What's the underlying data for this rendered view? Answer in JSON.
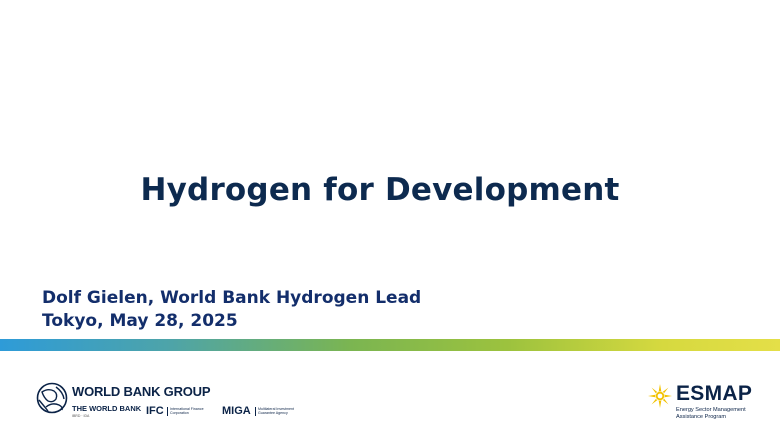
{
  "slide": {
    "title": "Hydrogen for Development",
    "presenter_line1": "Dolf Gielen, World Bank Hydrogen Lead",
    "presenter_line2": "Tokyo, May 28, 2025"
  },
  "colors": {
    "title": "#0d2a4f",
    "presenter": "#132e6b",
    "band_start": "#2e9bd8",
    "band_mid": "#7bb551",
    "band_end": "#e4df48"
  },
  "footer": {
    "wbg_name": "WORLD BANK GROUP",
    "wb_short": "THE WORLD BANK",
    "wb_small": "IBRD · IDA",
    "ifc": "IFC",
    "ifc_desc": "International Finance Corporation",
    "miga": "MIGA",
    "miga_desc": "Multilateral Investment Guarantee Agency",
    "esmap_name": "ESMAP",
    "esmap_desc_line1": "Energy Sector Management",
    "esmap_desc_line2": "Assistance Program"
  }
}
